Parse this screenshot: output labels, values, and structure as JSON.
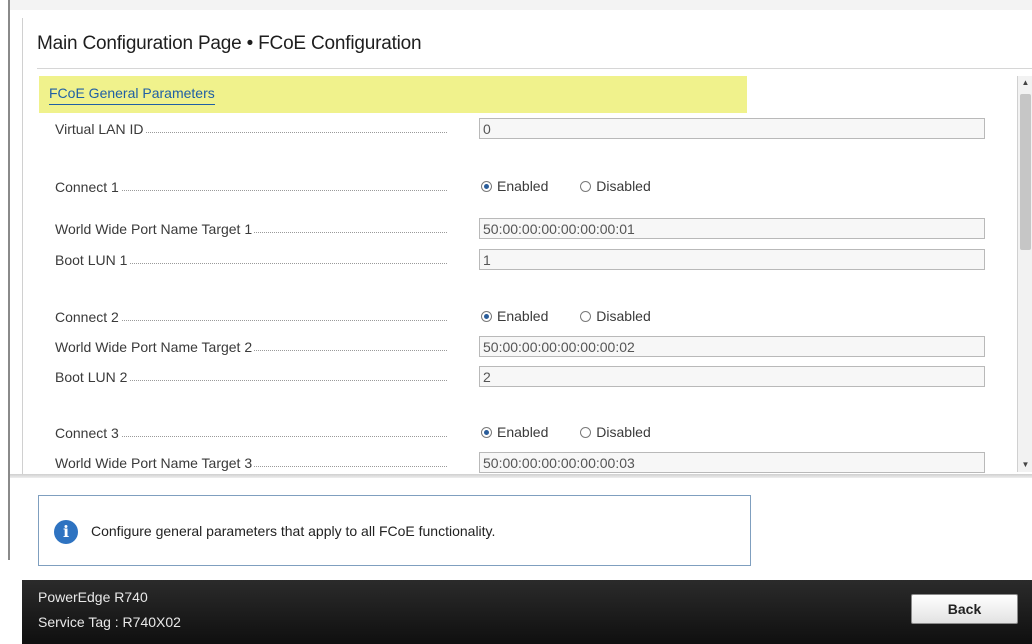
{
  "page": {
    "title": "Main Configuration Page • FCoE Configuration"
  },
  "section": {
    "label": "FCoE General Parameters"
  },
  "fields": {
    "vlan": {
      "label": "Virtual LAN ID",
      "value": "0"
    },
    "connect1": {
      "label": "Connect 1",
      "enabled_label": "Enabled",
      "disabled_label": "Disabled",
      "selected": "Enabled"
    },
    "wwpn1": {
      "label": "World Wide Port Name Target 1",
      "value": "50:00:00:00:00:00:00:01"
    },
    "lun1": {
      "label": "Boot LUN 1",
      "value": "1"
    },
    "connect2": {
      "label": "Connect 2",
      "enabled_label": "Enabled",
      "disabled_label": "Disabled",
      "selected": "Enabled"
    },
    "wwpn2": {
      "label": "World Wide Port Name Target 2",
      "value": "50:00:00:00:00:00:00:02"
    },
    "lun2": {
      "label": "Boot LUN 2",
      "value": "2"
    },
    "connect3": {
      "label": "Connect 3",
      "enabled_label": "Enabled",
      "disabled_label": "Disabled",
      "selected": "Enabled"
    },
    "wwpn3": {
      "label": "World Wide Port Name Target 3",
      "value": "50:00:00:00:00:00:00:03"
    }
  },
  "help": {
    "icon": "info-icon",
    "icon_glyph": "i",
    "text": "Configure general parameters that apply to all FCoE functionality."
  },
  "footer": {
    "model": "PowerEdge R740",
    "service_tag": "Service Tag : R740X02",
    "back_label": "Back"
  },
  "scrollbar": {
    "up_glyph": "▲",
    "down_glyph": "▼"
  },
  "colors": {
    "section_highlight": "#f0f28c",
    "link": "#1f5fa5",
    "info_icon": "#2e73c1",
    "footer_bg": "#1a1a1a"
  }
}
